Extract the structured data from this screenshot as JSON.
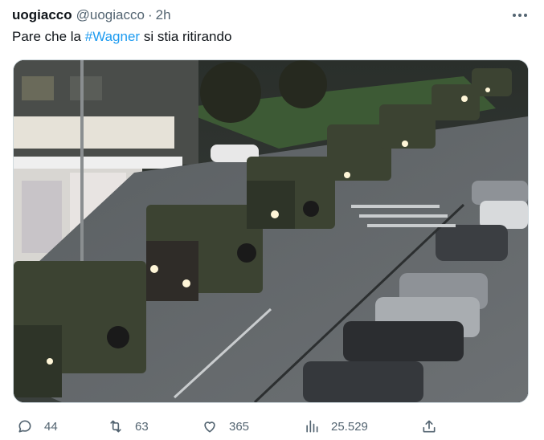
{
  "tweet": {
    "display_name": "uogiacco",
    "handle": "@uogiacco",
    "separator": "·",
    "time": "2h",
    "text_before": "Pare che la ",
    "hashtag": "#Wagner",
    "text_after": " si stia ritirando"
  },
  "media": {
    "icon": "photo-military-convoy-night-street"
  },
  "actions": {
    "reply": {
      "icon": "reply-icon",
      "count": "44"
    },
    "retweet": {
      "icon": "retweet-icon",
      "count": "63"
    },
    "like": {
      "icon": "heart-icon",
      "count": "365"
    },
    "views": {
      "icon": "views-icon",
      "count": "25.529"
    },
    "share": {
      "icon": "share-icon"
    }
  },
  "colors": {
    "text": "#0f1419",
    "secondary": "#536471",
    "accent": "#1d9bf0",
    "border": "#cfd9de"
  }
}
